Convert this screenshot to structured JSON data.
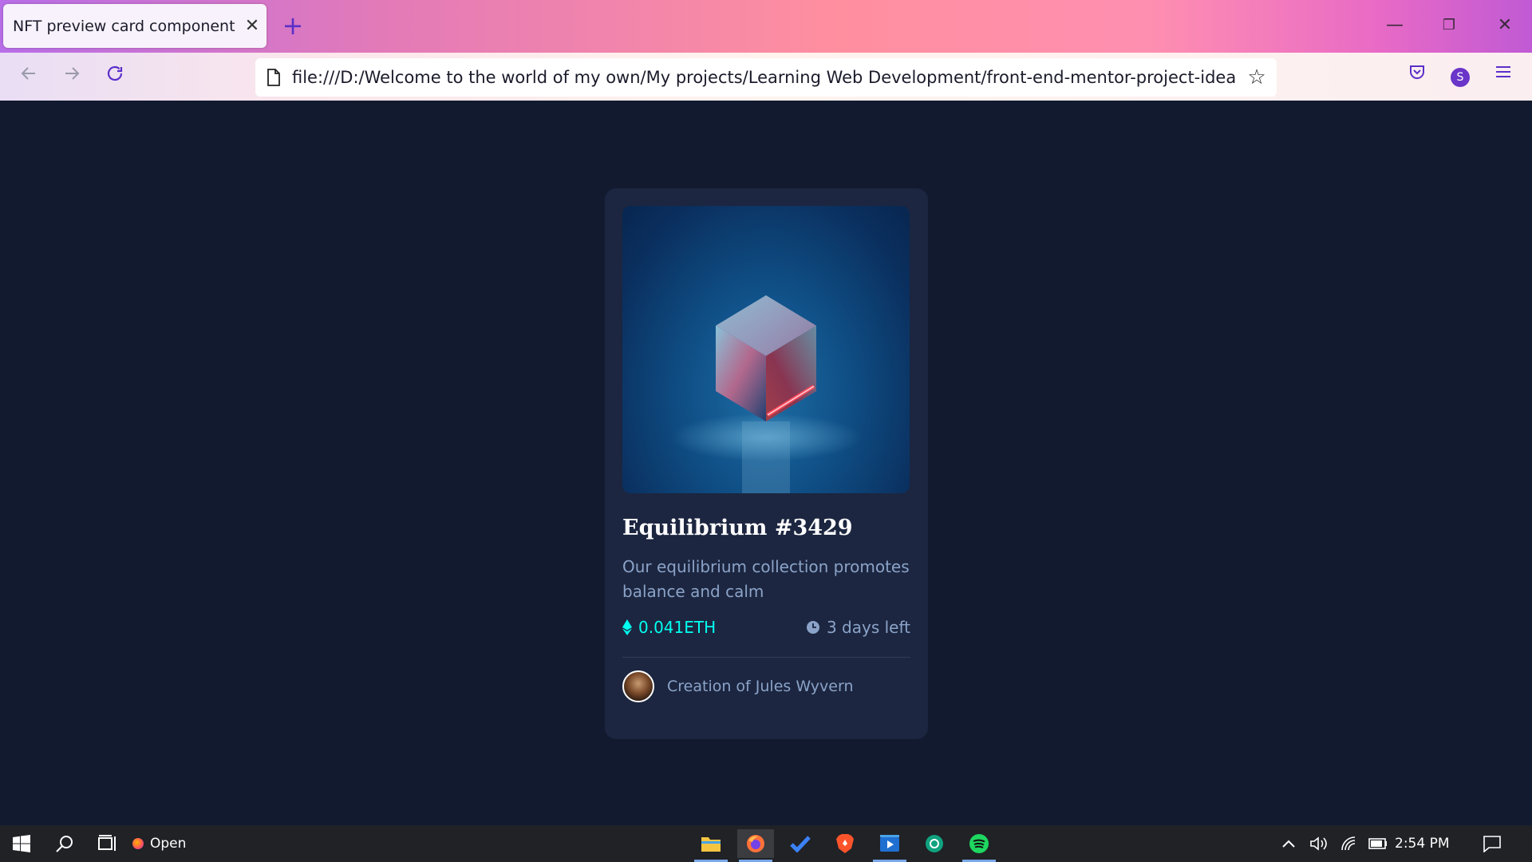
{
  "browser": {
    "tab_title": "NFT preview card component",
    "tab_close": "✕",
    "new_tab": "+",
    "url": "file:///D:/Welcome to the world of my own/My projects/Learning Web Development/front-end-mentor-project-ideas-(cloning-pra",
    "profile_initial": "S",
    "window_controls": {
      "minimize": "—",
      "restore": "❐",
      "close": "✕"
    }
  },
  "card": {
    "title": "Equilibrium #3429",
    "description": "Our equilibrium collection promotes balance and calm",
    "price": "0.041ETH",
    "time_left": "3 days left",
    "creator": "Creation of Jules Wyvern",
    "accent_color": "#00fff0"
  },
  "taskbar": {
    "search_open_label": "Open",
    "time": "2:54 PM",
    "apps": [
      "file-explorer-icon",
      "firefox-icon",
      "todo-icon",
      "brave-icon",
      "video-player-icon",
      "chatgpt-icon",
      "spotify-icon"
    ]
  },
  "colors": {
    "page_bg": "#121a30",
    "card_bg": "#1c2640",
    "muted_text": "#8ba3c8"
  }
}
